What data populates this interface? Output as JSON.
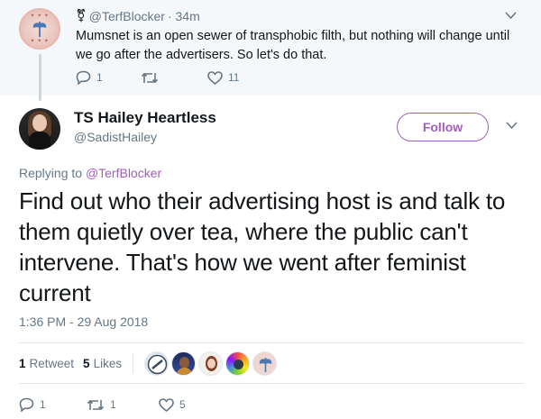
{
  "parent_tweet": {
    "author_handle": "@TerfBlocker",
    "time_ago": "· 34m",
    "text": "Mumsnet is an open sewer of transphobic filth, but nothing will change until we go after the advertisers. So let's do that.",
    "reply_count": "1",
    "retweet_count": "",
    "like_count": "11"
  },
  "main_tweet": {
    "display_name": "TS Hailey Heartless",
    "handle": "@SadistHailey",
    "follow_label": "Follow",
    "replying_prefix": "Replying to",
    "replying_to": "@TerfBlocker",
    "text": "Find out who their advertising host is and talk to them quietly over tea, where the public can't intervene. That's how we went after feminist current",
    "timestamp": "1:36 PM - 29 Aug 2018",
    "retweets_count": "1",
    "retweets_label": "Retweet",
    "likes_count": "5",
    "likes_label": "Likes",
    "reply_count": "1",
    "retweet_count": "1",
    "like_count": "5"
  },
  "colors": {
    "accent": "#a15eba",
    "secondary_text": "#657786",
    "primary_text": "#14171a",
    "parent_background": "#f5f8fa"
  },
  "icons": [
    "transgender-symbol-icon",
    "chevron-down-icon",
    "reply-icon",
    "retweet-icon",
    "like-heart-icon"
  ]
}
